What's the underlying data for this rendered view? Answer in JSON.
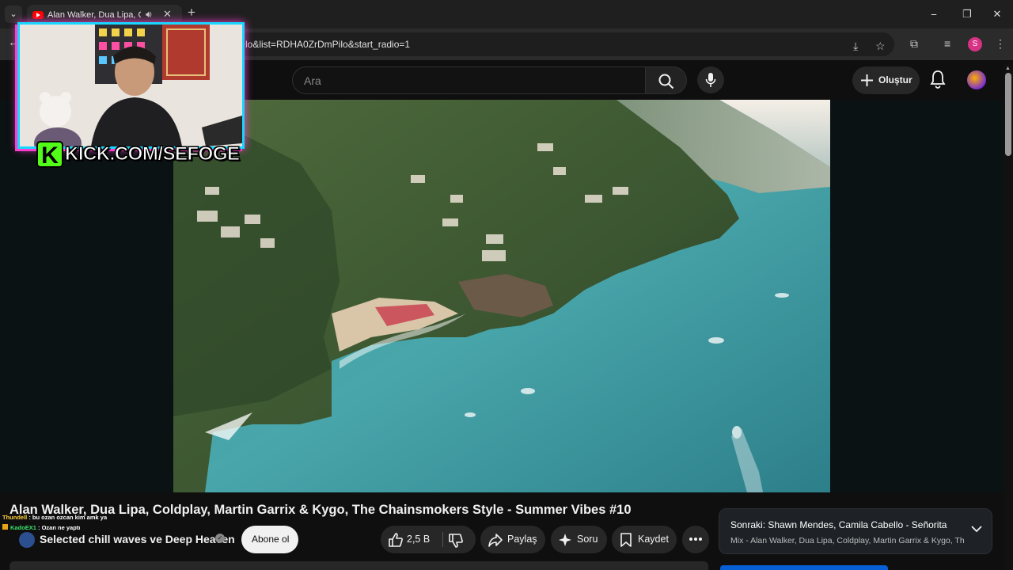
{
  "browser": {
    "tab_title": "Alan Walker, Dua Lipa, Cold",
    "tab_close": "✕",
    "new_tab": "+",
    "url": "lo&list=RDHA0ZrDmPilo&start_radio=1",
    "profile_initial": "S",
    "window_controls": [
      "⎯",
      "❐",
      "✕"
    ]
  },
  "youtube": {
    "search_placeholder": "Ara",
    "create_label": "Oluştur"
  },
  "overlay": {
    "kick_logo_letter": "K",
    "kick_url": "KICK.COM/SEFOGE",
    "chat": [
      {
        "user": "Thundell",
        "text": " : bu ozan ozcan kim amk ya",
        "color": "#ffd23c"
      },
      {
        "user": "KadoEX1",
        "text": " : Ozan ne yaptı",
        "color": "#39e36b"
      }
    ]
  },
  "video": {
    "title": "Alan Walker, Dua Lipa, Coldplay, Martin Garrix & Kygo, The Chainsmokers Style - Summer Vibes #10",
    "channel": "Selected chill waves ve Deep Heaven",
    "subscribe_label": "Abone ol",
    "likes": "2,5 B",
    "share_label": "Paylaş",
    "ask_label": "Soru",
    "save_label": "Kaydet"
  },
  "up_next": {
    "prefix": "Sonraki:",
    "title": " Shawn Mendes, Camila Cabello - Señorita",
    "subtitle": "Mix - Alan Walker, Dua Lipa, Coldplay, Martin Garrix & Kygo, The..."
  },
  "colors": {
    "kick_green": "#53fc18",
    "cam_border": "#19d6ff",
    "cam_glow": "#ff3fd0",
    "yt_red": "#ff0000"
  }
}
